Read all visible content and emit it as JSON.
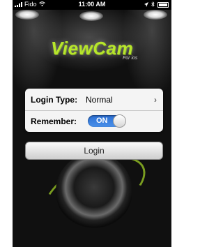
{
  "statusbar": {
    "carrier": "Fido",
    "time": "11:00 AM"
  },
  "app": {
    "logo": "ViewCam",
    "tagline": "For ios"
  },
  "form": {
    "login_type": {
      "label": "Login Type:",
      "value": "Normal"
    },
    "remember": {
      "label": "Remember:",
      "toggle_text": "ON",
      "state": "on"
    }
  },
  "login_button": {
    "label": "Login"
  },
  "colors": {
    "accent": "#b7e62b",
    "toggle_on": "#3a7fe0"
  },
  "icons": [
    "signal-icon",
    "wifi-icon",
    "location-icon",
    "bluetooth-icon",
    "battery-icon",
    "chevron-right-icon"
  ]
}
